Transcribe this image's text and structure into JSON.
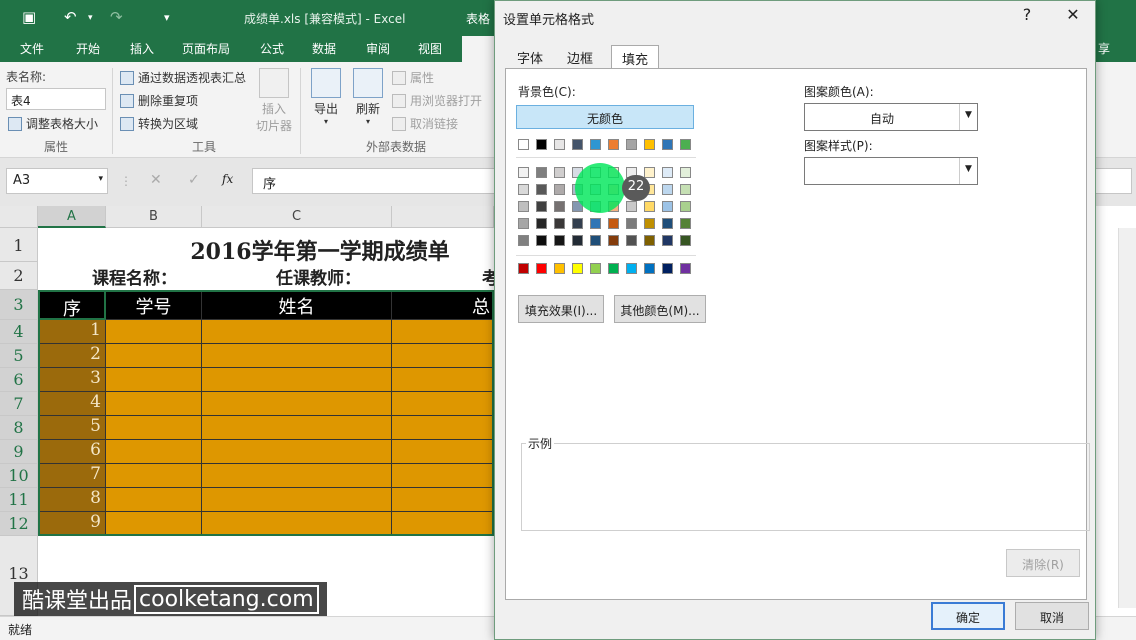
{
  "window": {
    "title": "成绩单.xls  [兼容模式] - Excel",
    "title_tab": "表格"
  },
  "menu": [
    "文件",
    "开始",
    "插入",
    "页面布局",
    "公式",
    "数据",
    "审阅",
    "视图",
    "设"
  ],
  "menu_right": "享",
  "ribbon": {
    "table_name_label": "表名称:",
    "table_name_value": "表4",
    "resize_table": "调整表格大小",
    "group_properties": "属性",
    "pivot_summary": "通过数据透视表汇总",
    "remove_duplicates": "删除重复项",
    "convert_range": "转换为区域",
    "group_tools": "工具",
    "insert_slicer": [
      "插入",
      "切片器"
    ],
    "export": "导出",
    "refresh": "刷新",
    "properties": "属性",
    "open_browser": "用浏览器打开",
    "unlink": "取消链接",
    "group_external": "外部表数据"
  },
  "formula_bar": {
    "name_box": "A3",
    "fx": "fx",
    "content": "序"
  },
  "sheet": {
    "columns": [
      "A",
      "B",
      "C"
    ],
    "rows": [
      "1",
      "2",
      "3",
      "4",
      "5",
      "6",
      "7",
      "8",
      "9",
      "10",
      "11",
      "12",
      "13"
    ],
    "title": "2016学年第一学期成绩单",
    "course_label": "课程名称：",
    "teacher_label": "任课教师：",
    "exam_label": "考",
    "headers": [
      "序",
      "学号",
      "姓名",
      "总"
    ],
    "seq": [
      "1",
      "2",
      "3",
      "4",
      "5",
      "6",
      "7",
      "8",
      "9"
    ]
  },
  "status": "就绪",
  "dialog": {
    "title": "设置单元格格式",
    "help": "?",
    "close": "✕",
    "tabs": [
      "字体",
      "边框",
      "填充"
    ],
    "bg_color_label": "背景色(C):",
    "no_color": "无颜色",
    "pattern_color_label": "图案颜色(A):",
    "pattern_color_value": "自动",
    "pattern_style_label": "图案样式(P):",
    "pattern_style_value": "",
    "fill_effects": "填充效果(I)...",
    "more_colors": "其他颜色(M)...",
    "sample_label": "示例",
    "clear": "清除(R)",
    "ok": "确定",
    "cancel": "取消",
    "theme_row": [
      "#ffffff",
      "#000000",
      "#e7e6e6",
      "#44546a",
      "#2e96d2",
      "#ed7d31",
      "#a5a5a5",
      "#ffc000",
      "#2e75b6",
      "#4caf50"
    ],
    "shade_rows": [
      [
        "#f2f2f2",
        "#7f7f7f",
        "#d0cece",
        "#d6dce4",
        "#ddebf7",
        "#fbe5d6",
        "#ededed",
        "#fff2cc",
        "#deebf7",
        "#e2efda"
      ],
      [
        "#d9d9d9",
        "#595959",
        "#aeaaaa",
        "#adb9ca",
        "#bdd7ee",
        "#f8cbad",
        "#dbdbdb",
        "#ffe699",
        "#bdd7ee",
        "#c6e0b4"
      ],
      [
        "#bfbfbf",
        "#404040",
        "#767171",
        "#8497b0",
        "#9bc2e6",
        "#f4b183",
        "#c9c9c9",
        "#ffd966",
        "#9dc3e6",
        "#a9d08e"
      ],
      [
        "#a6a6a6",
        "#262626",
        "#3a3838",
        "#333f4f",
        "#2f75b5",
        "#c55a11",
        "#7b7b7b",
        "#bf8f00",
        "#1f4e79",
        "#548235"
      ],
      [
        "#808080",
        "#0d0d0d",
        "#161616",
        "#222b35",
        "#1f4e78",
        "#843c0c",
        "#525252",
        "#7f6000",
        "#203764",
        "#375623"
      ]
    ],
    "standard_row": [
      "#c00000",
      "#ff0000",
      "#ffc000",
      "#ffff00",
      "#92d050",
      "#00b050",
      "#00b0f0",
      "#0070c0",
      "#002060",
      "#7030a0"
    ]
  },
  "overlay": {
    "badge": "22",
    "watermark_a": "酷课堂出品",
    "watermark_b": "coolketang.com"
  }
}
